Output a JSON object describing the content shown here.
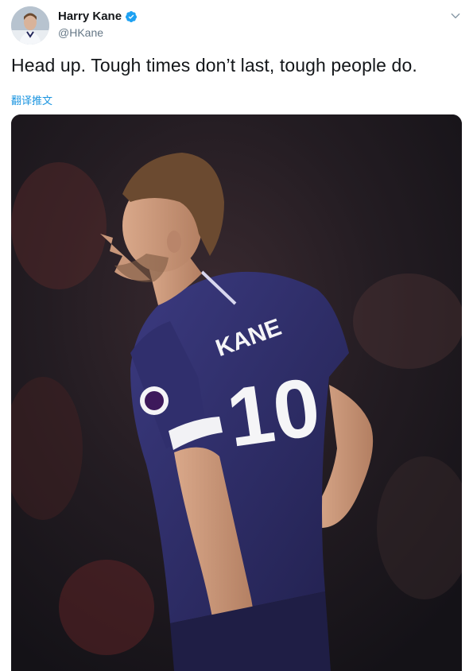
{
  "tweet": {
    "author": {
      "display_name": "Harry Kane",
      "handle": "@HKane",
      "verified": true,
      "avatar_icon": "avatar-photo"
    },
    "text": "Head up. Tough times don’t last, tough people do.",
    "translate_label": "翻译推文",
    "menu_icon": "chevron-down-icon",
    "media": {
      "kind": "photo",
      "jersey_name": "KANE",
      "jersey_number": "10"
    }
  },
  "colors": {
    "link": "#1b95e0",
    "verified": "#1da1f2",
    "handle": "#657786",
    "jersey": "#2b2a63"
  }
}
